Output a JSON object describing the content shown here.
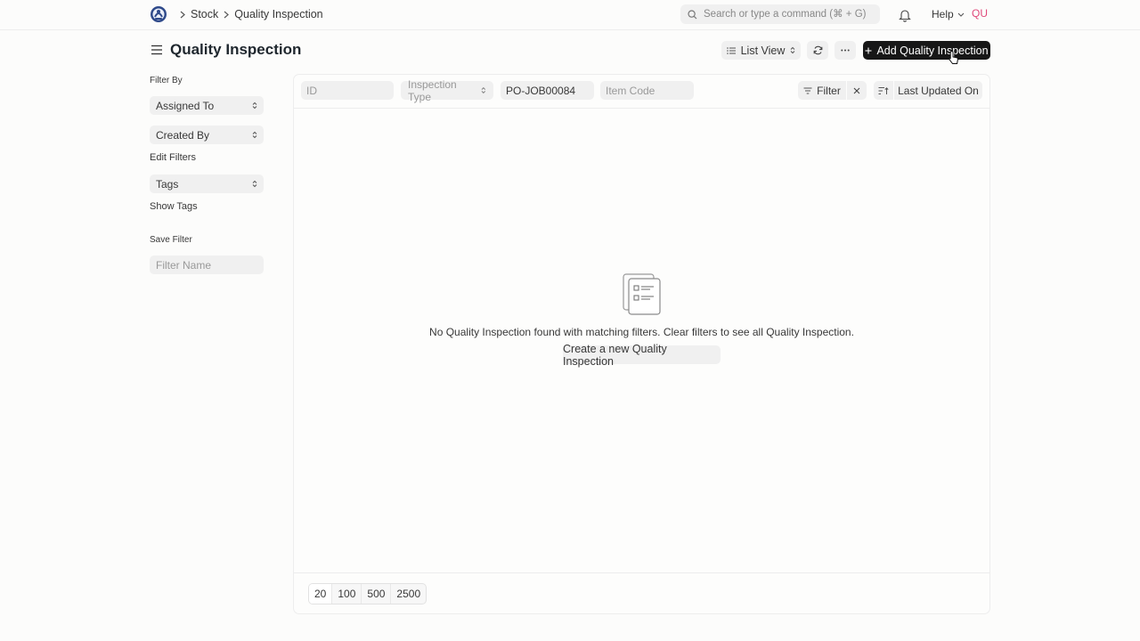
{
  "navbar": {
    "breadcrumbs": [
      "Stock",
      "Quality Inspection"
    ],
    "search_placeholder": "Search or type a command (⌘ + G)",
    "help_label": "Help",
    "avatar_initials": "QU"
  },
  "header": {
    "title": "Quality Inspection",
    "list_view_label": "List View",
    "add_button_label": "Add Quality Inspection"
  },
  "sidebar": {
    "filter_by_label": "Filter By",
    "assigned_to_label": "Assigned To",
    "created_by_label": "Created By",
    "edit_filters_label": "Edit Filters",
    "tags_label": "Tags",
    "show_tags_label": "Show Tags",
    "save_filter_label": "Save Filter",
    "filter_name_placeholder": "Filter Name"
  },
  "filters": {
    "id_placeholder": "ID",
    "inspection_type_label": "Inspection Type",
    "reference_value": "PO-JOB00084",
    "item_code_placeholder": "Item Code",
    "filter_label": "Filter",
    "sort_label": "Last Updated On"
  },
  "empty_state": {
    "message": "No Quality Inspection found with matching filters. Clear filters to see all Quality Inspection.",
    "create_label": "Create a new Quality Inspection"
  },
  "paging": {
    "options": [
      "20",
      "100",
      "500",
      "2500"
    ],
    "selected": "20"
  },
  "colors": {
    "avatar": "#e0497a",
    "primary_button": "#171717"
  }
}
